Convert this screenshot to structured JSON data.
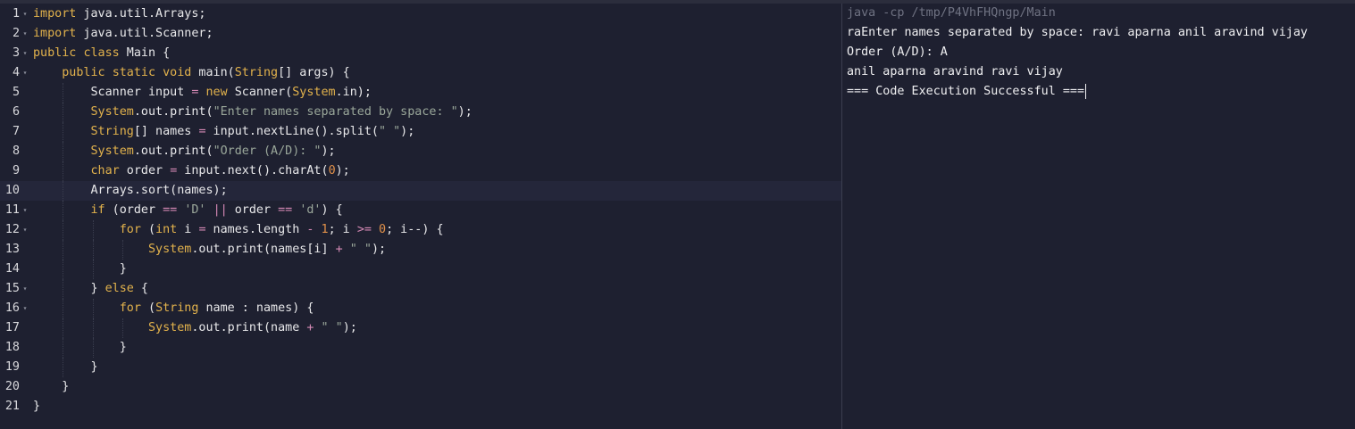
{
  "editor": {
    "language": "java",
    "active_line": 10,
    "lines": [
      {
        "n": "1",
        "fold": true,
        "indent": 0,
        "tokens": [
          [
            "kw",
            "import"
          ],
          [
            "pl",
            " java.util.Arrays;"
          ]
        ]
      },
      {
        "n": "2",
        "fold": true,
        "indent": 0,
        "tokens": [
          [
            "kw",
            "import"
          ],
          [
            "pl",
            " java.util.Scanner;"
          ]
        ]
      },
      {
        "n": "3",
        "fold": true,
        "indent": 0,
        "tokens": [
          [
            "kw",
            "public"
          ],
          [
            "pl",
            " "
          ],
          [
            "kw",
            "class"
          ],
          [
            "pl",
            " Main {"
          ]
        ]
      },
      {
        "n": "4",
        "fold": true,
        "indent": 1,
        "tokens": [
          [
            "pl",
            "    "
          ],
          [
            "kw",
            "public"
          ],
          [
            "pl",
            " "
          ],
          [
            "kw",
            "static"
          ],
          [
            "pl",
            " "
          ],
          [
            "kw",
            "void"
          ],
          [
            "pl",
            " main("
          ],
          [
            "ty",
            "String"
          ],
          [
            "pl",
            "[] args) {"
          ]
        ]
      },
      {
        "n": "5",
        "fold": false,
        "indent": 2,
        "tokens": [
          [
            "pl",
            "        Scanner input "
          ],
          [
            "op",
            "="
          ],
          [
            "pl",
            " "
          ],
          [
            "kw",
            "new"
          ],
          [
            "pl",
            " Scanner("
          ],
          [
            "ty",
            "System"
          ],
          [
            "pl",
            ".in);"
          ]
        ]
      },
      {
        "n": "6",
        "fold": false,
        "indent": 2,
        "tokens": [
          [
            "pl",
            "        "
          ],
          [
            "ty",
            "System"
          ],
          [
            "pl",
            ".out.print("
          ],
          [
            "str",
            "\"Enter names separated by space: \""
          ],
          [
            "pl",
            ");"
          ]
        ]
      },
      {
        "n": "7",
        "fold": false,
        "indent": 2,
        "tokens": [
          [
            "pl",
            "        "
          ],
          [
            "ty",
            "String"
          ],
          [
            "pl",
            "[] names "
          ],
          [
            "op",
            "="
          ],
          [
            "pl",
            " input.nextLine().split("
          ],
          [
            "str",
            "\" \""
          ],
          [
            "pl",
            ");"
          ]
        ]
      },
      {
        "n": "8",
        "fold": false,
        "indent": 2,
        "tokens": [
          [
            "pl",
            "        "
          ],
          [
            "ty",
            "System"
          ],
          [
            "pl",
            ".out.print("
          ],
          [
            "str",
            "\"Order (A/D): \""
          ],
          [
            "pl",
            ");"
          ]
        ]
      },
      {
        "n": "9",
        "fold": false,
        "indent": 2,
        "tokens": [
          [
            "pl",
            "        "
          ],
          [
            "kw",
            "char"
          ],
          [
            "pl",
            " order "
          ],
          [
            "op",
            "="
          ],
          [
            "pl",
            " input.next().charAt("
          ],
          [
            "num",
            "0"
          ],
          [
            "pl",
            ");"
          ]
        ]
      },
      {
        "n": "10",
        "fold": false,
        "indent": 2,
        "tokens": [
          [
            "pl",
            "        Arrays.sort(names);"
          ]
        ]
      },
      {
        "n": "11",
        "fold": true,
        "indent": 2,
        "tokens": [
          [
            "pl",
            "        "
          ],
          [
            "kw",
            "if"
          ],
          [
            "pl",
            " (order "
          ],
          [
            "op",
            "=="
          ],
          [
            "pl",
            " "
          ],
          [
            "str",
            "'D'"
          ],
          [
            "pl",
            " "
          ],
          [
            "op",
            "||"
          ],
          [
            "pl",
            " order "
          ],
          [
            "op",
            "=="
          ],
          [
            "pl",
            " "
          ],
          [
            "str",
            "'d'"
          ],
          [
            "pl",
            ") {"
          ]
        ]
      },
      {
        "n": "12",
        "fold": true,
        "indent": 3,
        "tokens": [
          [
            "pl",
            "            "
          ],
          [
            "kw",
            "for"
          ],
          [
            "pl",
            " ("
          ],
          [
            "kw",
            "int"
          ],
          [
            "pl",
            " i "
          ],
          [
            "op",
            "="
          ],
          [
            "pl",
            " names.length "
          ],
          [
            "op",
            "-"
          ],
          [
            "pl",
            " "
          ],
          [
            "num",
            "1"
          ],
          [
            "pl",
            "; i "
          ],
          [
            "op",
            ">="
          ],
          [
            "pl",
            " "
          ],
          [
            "num",
            "0"
          ],
          [
            "pl",
            "; i--) {"
          ]
        ]
      },
      {
        "n": "13",
        "fold": false,
        "indent": 4,
        "tokens": [
          [
            "pl",
            "                "
          ],
          [
            "ty",
            "System"
          ],
          [
            "pl",
            ".out.print(names[i] "
          ],
          [
            "op",
            "+"
          ],
          [
            "pl",
            " "
          ],
          [
            "str",
            "\" \""
          ],
          [
            "pl",
            ");"
          ]
        ]
      },
      {
        "n": "14",
        "fold": false,
        "indent": 3,
        "tokens": [
          [
            "pl",
            "            }"
          ]
        ]
      },
      {
        "n": "15",
        "fold": true,
        "indent": 2,
        "tokens": [
          [
            "pl",
            "        } "
          ],
          [
            "kw",
            "else"
          ],
          [
            "pl",
            " {"
          ]
        ]
      },
      {
        "n": "16",
        "fold": true,
        "indent": 3,
        "tokens": [
          [
            "pl",
            "            "
          ],
          [
            "kw",
            "for"
          ],
          [
            "pl",
            " ("
          ],
          [
            "ty",
            "String"
          ],
          [
            "pl",
            " name : names) {"
          ]
        ]
      },
      {
        "n": "17",
        "fold": false,
        "indent": 4,
        "tokens": [
          [
            "pl",
            "                "
          ],
          [
            "ty",
            "System"
          ],
          [
            "pl",
            ".out.print(name "
          ],
          [
            "op",
            "+"
          ],
          [
            "pl",
            " "
          ],
          [
            "str",
            "\" \""
          ],
          [
            "pl",
            ");"
          ]
        ]
      },
      {
        "n": "18",
        "fold": false,
        "indent": 3,
        "tokens": [
          [
            "pl",
            "            }"
          ]
        ]
      },
      {
        "n": "19",
        "fold": false,
        "indent": 2,
        "tokens": [
          [
            "pl",
            "        }"
          ]
        ]
      },
      {
        "n": "20",
        "fold": false,
        "indent": 1,
        "tokens": [
          [
            "pl",
            "    }"
          ]
        ]
      },
      {
        "n": "21",
        "fold": false,
        "indent": 0,
        "tokens": [
          [
            "pl",
            "}"
          ]
        ]
      }
    ],
    "fold_icon": "chevron-down-icon"
  },
  "output": {
    "command": "java -cp /tmp/P4VhFHQngp/Main",
    "lines": [
      "raEnter names separated by space: ravi aparna anil aravind vijay",
      "Order (A/D): A",
      "anil aparna aravind ravi vijay",
      "=== Code Execution Successful ==="
    ]
  },
  "colors": {
    "background": "#1e2030",
    "keyword": "#e2b24c",
    "string": "#9aa79a",
    "number": "#e0904a",
    "operator": "#d68ab6",
    "text": "#e8e8ea"
  }
}
